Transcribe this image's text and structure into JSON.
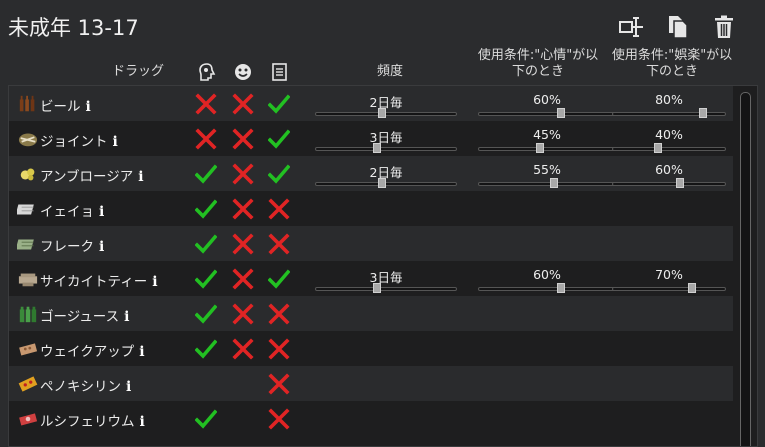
{
  "window": {
    "title": "未成年 13-17"
  },
  "toolbar": {
    "icons": [
      "rename-icon",
      "copy-icon",
      "delete-icon"
    ]
  },
  "headers": {
    "drug": "ドラッグ",
    "addiction_col_icon": "addiction-icon",
    "joy_col_icon": "smiley-icon",
    "schedule_col_icon": "checklist-icon",
    "frequency": "頻度",
    "mood_condition_line1": "使用条件:\"心情\"が以",
    "mood_condition_line2": "下のとき",
    "recreation_condition_line1": "使用条件:\"娯楽\"が以",
    "recreation_condition_line2": "下のとき"
  },
  "rows": [
    {
      "name": "ビール",
      "icon": "beer-bottles-icon",
      "c1": "cross",
      "c2": "cross",
      "c3": "check",
      "freq": "2日毎",
      "mood": "60%",
      "mood_frac": 0.6,
      "rec": "80%",
      "rec_frac": 0.8,
      "freq_frac": 0.47
    },
    {
      "name": "ジョイント",
      "icon": "joint-pile-icon",
      "c1": "cross",
      "c2": "cross",
      "c3": "check",
      "freq": "3日毎",
      "mood": "45%",
      "mood_frac": 0.45,
      "rec": "40%",
      "rec_frac": 0.4,
      "freq_frac": 0.44
    },
    {
      "name": "アンブロージア",
      "icon": "ambrosia-icon",
      "c1": "check",
      "c2": "cross",
      "c3": "check",
      "freq": "2日毎",
      "mood": "55%",
      "mood_frac": 0.55,
      "rec": "60%",
      "rec_frac": 0.6,
      "freq_frac": 0.47
    },
    {
      "name": "イェイョ",
      "icon": "yayo-icon",
      "c1": "check",
      "c2": "cross",
      "c3": "cross"
    },
    {
      "name": "フレーク",
      "icon": "flake-icon",
      "c1": "check",
      "c2": "cross",
      "c3": "cross"
    },
    {
      "name": "サイカイトティー",
      "icon": "psychite-tea-icon",
      "c1": "check",
      "c2": "cross",
      "c3": "check",
      "freq": "3日毎",
      "mood": "60%",
      "mood_frac": 0.6,
      "rec": "70%",
      "rec_frac": 0.7,
      "freq_frac": 0.44
    },
    {
      "name": "ゴージュース",
      "icon": "go-juice-icon",
      "c1": "check",
      "c2": "cross",
      "c3": "cross"
    },
    {
      "name": "ウェイクアップ",
      "icon": "wake-up-icon",
      "c1": "check",
      "c2": "cross",
      "c3": "cross"
    },
    {
      "name": "ペノキシリン",
      "icon": "penoxycyline-icon",
      "c1": "",
      "c2": "",
      "c3": "cross"
    },
    {
      "name": "ルシフェリウム",
      "icon": "luciferium-icon",
      "c1": "check",
      "c2": "",
      "c3": "cross"
    }
  ],
  "colors": {
    "check": "#22c022",
    "cross": "#e02424",
    "background": "#2b2c2e",
    "table_bg": "#1e1e1f",
    "row_alt": "#2a2b2d"
  },
  "info_glyph": "i"
}
